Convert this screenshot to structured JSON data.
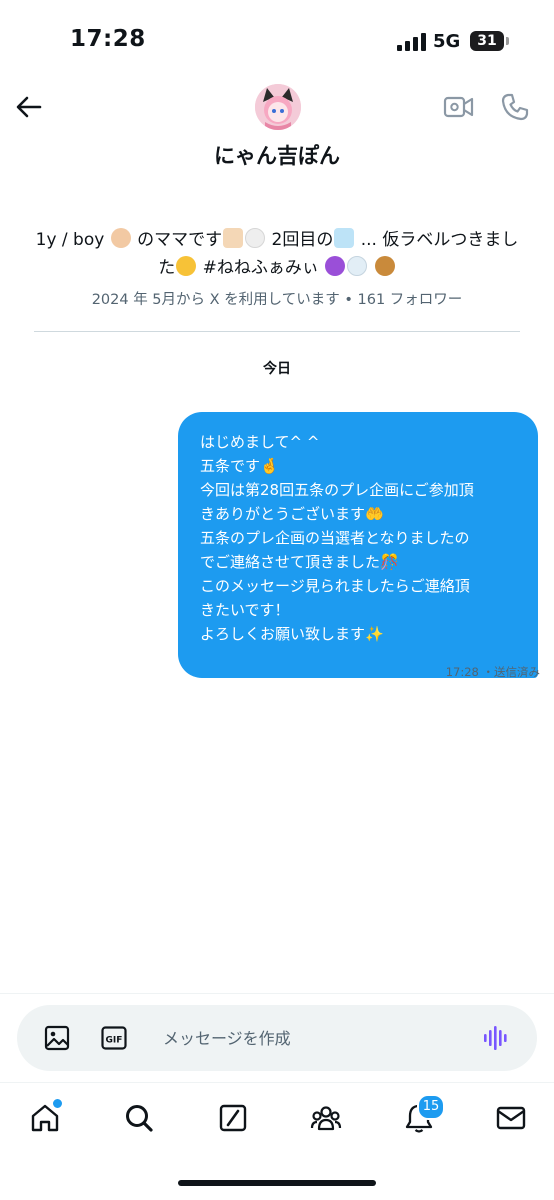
{
  "status_bar": {
    "time": "17:28",
    "network": "5G",
    "battery": "31"
  },
  "header": {
    "name": "にゃん吉ぽん"
  },
  "profile": {
    "bio_line1": [
      "1y / boy",
      "のママです",
      "2回目の",
      "... 仮ラベルつきまし"
    ],
    "bio_line2": [
      "た",
      "#ねねふぁみぃ"
    ],
    "joined": "2024 年 5月から X を利用しています • 161 フォロワー"
  },
  "conversation": {
    "date_separator": "今日",
    "messages": [
      {
        "lines": [
          "はじめまして^ ^",
          "五条です🤞",
          "今回は第28回五条のプレ企画にご参加頂",
          "きありがとうございます🤲",
          "五条のプレ企画の当選者となりましたの",
          "でご連絡させて頂きました🎊",
          "このメッセージ見られましたらご連絡頂",
          "きたいです！",
          "よろしくお願い致します✨"
        ],
        "time": "17:28",
        "status": "・送信済み"
      }
    ]
  },
  "composer": {
    "placeholder": "メッセージを作成"
  },
  "tab_bar": {
    "items": [
      "home-icon",
      "search-icon",
      "grok-icon",
      "communities-icon",
      "notifications-icon",
      "messages-icon"
    ],
    "notification_count": "15"
  },
  "colors": {
    "accent": "#1d9bf0",
    "text": "#0f1419",
    "muted": "#536471"
  }
}
